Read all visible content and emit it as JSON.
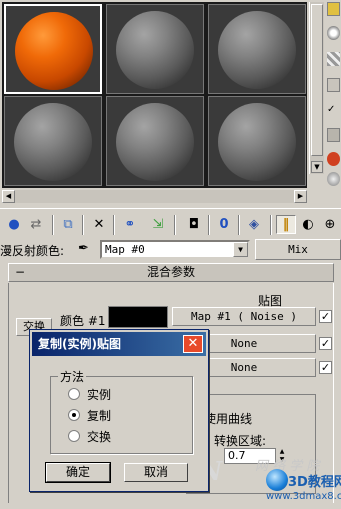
{
  "slots": [
    {
      "material": "orange",
      "selected": true
    },
    {
      "material": "gray",
      "selected": false
    },
    {
      "material": "gray",
      "selected": false
    },
    {
      "material": "gray",
      "selected": false
    },
    {
      "material": "gray",
      "selected": false
    },
    {
      "material": "gray",
      "selected": false
    }
  ],
  "toolbar": {
    "icons": [
      "get-material-icon",
      "put-to-scene-icon",
      "assign-to-selection-icon",
      "reset-map-icon",
      "make-unique-icon",
      "put-to-library-icon",
      "material-effects-channel-icon",
      "show-map-in-viewport-icon",
      "show-end-result-icon",
      "go-to-parent-icon",
      "go-forward-to-sibling-icon"
    ]
  },
  "maprow": {
    "label": "漫反射颜色:",
    "map_name": "Map #0",
    "map_type": "Mix"
  },
  "rollout": {
    "title": "混合参数",
    "maps_header": "贴图",
    "swap_label": "交换",
    "color1_label": "颜色 #1",
    "map1": "Map #1  ( Noise )",
    "map2": "None",
    "map3": "None",
    "use_curve_label": "使用曲线",
    "transition_zone_label": "转换区域:",
    "transition_value": "0.7"
  },
  "dialog": {
    "title": "复制(实例)贴图",
    "method_label": "方法",
    "options": [
      "实例",
      "复制",
      "交换"
    ],
    "selected": "复制",
    "ok_label": "确定",
    "cancel_label": "取消"
  },
  "watermark": {
    "brand": "3D教程网",
    "url": "www.3dmax8.cn",
    "faint_text": "网 络 学 院"
  },
  "colors": {
    "titlebar_start": "#0a246a",
    "titlebar_end": "#3a6ea5",
    "close_button": "#e84a2a",
    "orange_material": "#f06a08"
  }
}
